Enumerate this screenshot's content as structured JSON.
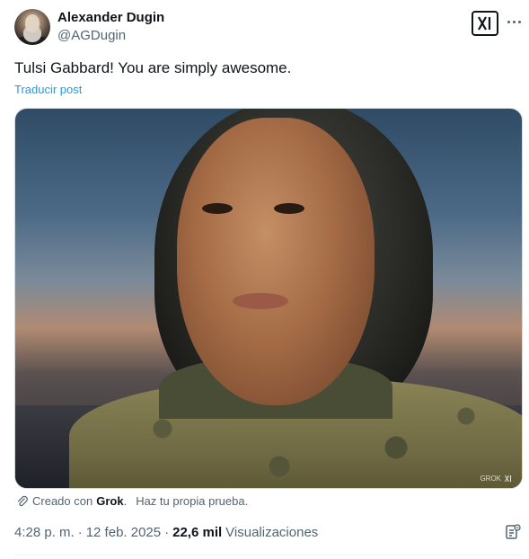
{
  "author": {
    "name": "Alexander Dugin",
    "handle": "@AGDugin"
  },
  "tweet": {
    "text": "Tulsi Gabbard! You are simply awesome.",
    "translate_label": "Traducir post"
  },
  "media": {
    "watermark": "GROK"
  },
  "grok_note": {
    "prefix": "Creado con",
    "brand": "Grok",
    "punct": ".",
    "cta": "Haz tu propia prueba."
  },
  "meta": {
    "time": "4:28 p. m.",
    "sep1": "·",
    "date": "12 feb. 2025",
    "sep2": "·",
    "views_count": "22,6 mil",
    "views_label": "Visualizaciones"
  },
  "icons": {
    "grok_badge": "grok-logo-icon",
    "more": "more-dots-icon",
    "link": "paperclip-icon",
    "analytics": "post-analytics-icon"
  },
  "colors": {
    "text": "#0f1419",
    "muted": "#536471",
    "link": "#1d9bf0",
    "border": "#cfd9de"
  }
}
